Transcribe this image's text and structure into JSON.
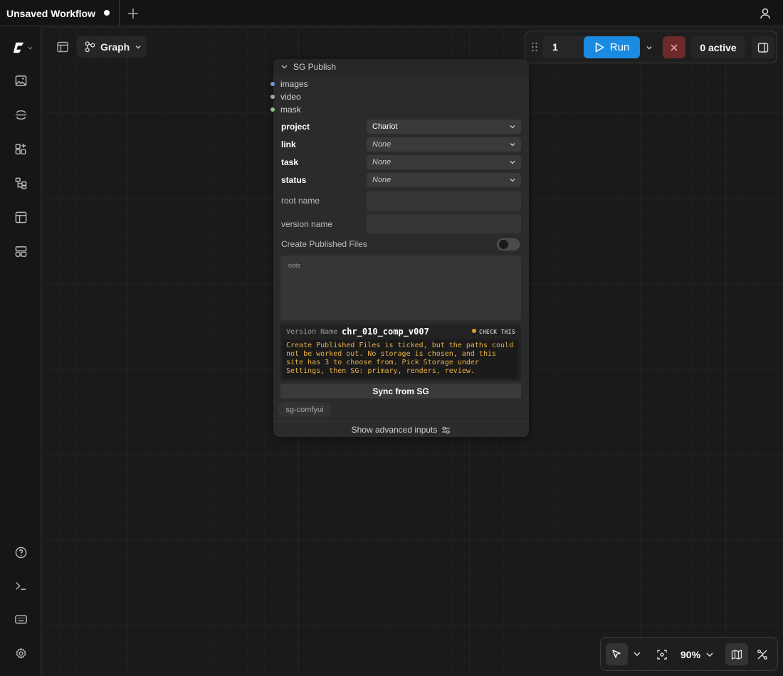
{
  "tabs": [
    {
      "label": "Unsaved Workflow",
      "unsaved": true
    }
  ],
  "canvas": {
    "view_label": "Graph"
  },
  "runbar": {
    "count": "1",
    "run_label": "Run",
    "active_label": "0 active"
  },
  "node": {
    "title": "SG Publish",
    "inputs": [
      {
        "label": "images",
        "color": "#6b9bd8"
      },
      {
        "label": "video",
        "color": "#9aa8a0"
      },
      {
        "label": "mask",
        "color": "#8fc08a"
      }
    ],
    "project": {
      "label": "project",
      "value": "Chariot"
    },
    "link": {
      "label": "link",
      "value": "None"
    },
    "task": {
      "label": "task",
      "value": "None"
    },
    "status": {
      "label": "status",
      "value": "None"
    },
    "root_name": {
      "label": "root name",
      "value": ""
    },
    "version_name": {
      "label": "version name",
      "value": ""
    },
    "create_published": {
      "label": "Create Published Files",
      "on": false
    },
    "note_placeholder": "note",
    "preview": {
      "label": "Version Name",
      "value": "chr_010_comp_v007",
      "check": "CHECK THIS",
      "warning": "Create Published Files is ticked, but the paths could not be worked out. No storage is chosen, and this site has 3 to choose from. Pick Storage under Settings, then SG: primary, renders, review."
    },
    "sync_label": "Sync from SG",
    "badge": "sg-comfyui",
    "advanced_label": "Show advanced inputs"
  },
  "bottombar": {
    "zoom": "90%"
  },
  "colors": {
    "run": "#1a8be0",
    "stop": "#6e2a2a",
    "warning": "#e8b04a"
  }
}
